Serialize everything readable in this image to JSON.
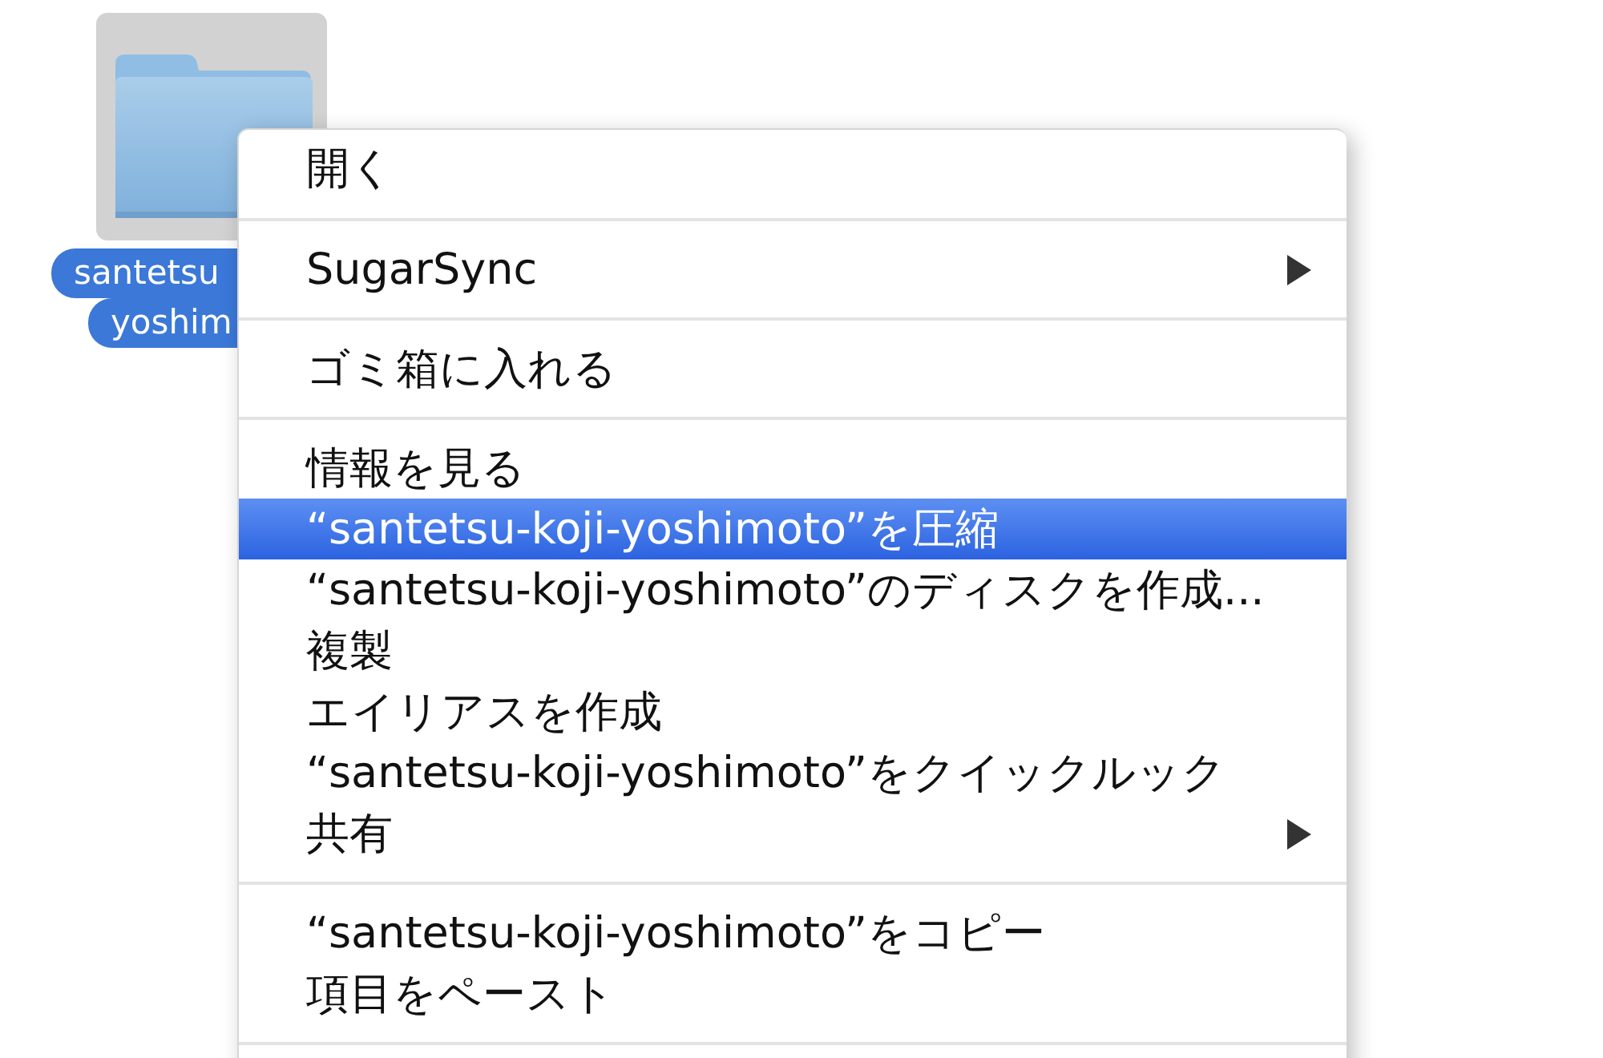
{
  "desktop_item": {
    "label_lines": [
      "santetsu",
      "yoshim"
    ],
    "selected": true
  },
  "context_menu": {
    "sections": [
      {
        "items": [
          {
            "label": "開く",
            "submenu": false,
            "selected": false
          }
        ]
      },
      {
        "items": [
          {
            "label": "SugarSync",
            "submenu": true,
            "selected": false
          }
        ]
      },
      {
        "items": [
          {
            "label": "ゴミ箱に入れる",
            "submenu": false,
            "selected": false
          }
        ]
      },
      {
        "items": [
          {
            "label": "情報を見る",
            "submenu": false,
            "selected": false
          },
          {
            "label": "“santetsu-koji-yoshimoto”を圧縮",
            "submenu": false,
            "selected": true
          },
          {
            "label": "“santetsu-koji-yoshimoto”のディスクを作成...",
            "submenu": false,
            "selected": false
          },
          {
            "label": "複製",
            "submenu": false,
            "selected": false
          },
          {
            "label": "エイリアスを作成",
            "submenu": false,
            "selected": false
          },
          {
            "label": "“santetsu-koji-yoshimoto”をクイックルック",
            "submenu": false,
            "selected": false
          },
          {
            "label": "共有",
            "submenu": true,
            "selected": false
          }
        ]
      },
      {
        "items": [
          {
            "label": "“santetsu-koji-yoshimoto”をコピー",
            "submenu": false,
            "selected": false
          },
          {
            "label": "項目をペースト",
            "submenu": false,
            "selected": false
          }
        ]
      }
    ]
  }
}
